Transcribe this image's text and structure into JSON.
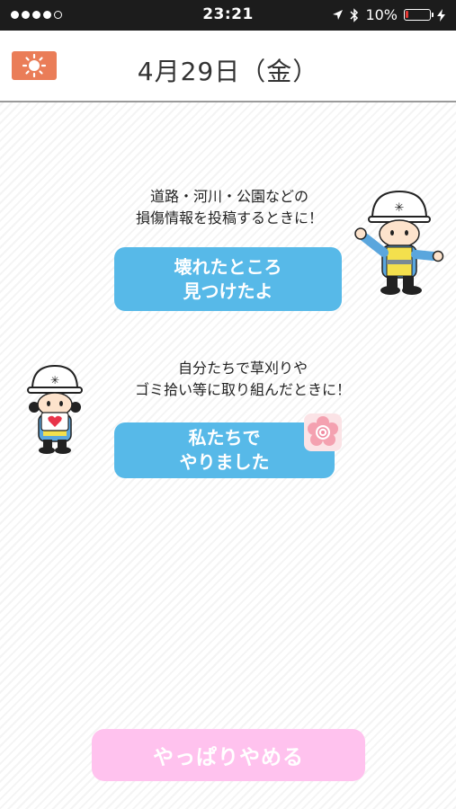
{
  "status_bar": {
    "time": "23:21",
    "battery": "10%",
    "battery_level": 0.1
  },
  "header": {
    "date": "4月29日（金）",
    "weather_icon": "sun-icon"
  },
  "report": {
    "caption_line1": "道路・河川・公園などの",
    "caption_line2": "損傷情報を投稿するときに！",
    "button_line1": "壊れたところ",
    "button_line2": "見つけたよ"
  },
  "activity": {
    "caption_line1": "自分たちで草刈りや",
    "caption_line2": "ゴミ拾い等に取り組んだときに！",
    "button_line1": "私たちで",
    "button_line2": "やりました"
  },
  "cancel_label": "やっぱりやめる",
  "colors": {
    "accent_blue": "#57b9e8",
    "cancel_pink": "#ffc2ee",
    "weather_orange": "#ea7d58"
  }
}
